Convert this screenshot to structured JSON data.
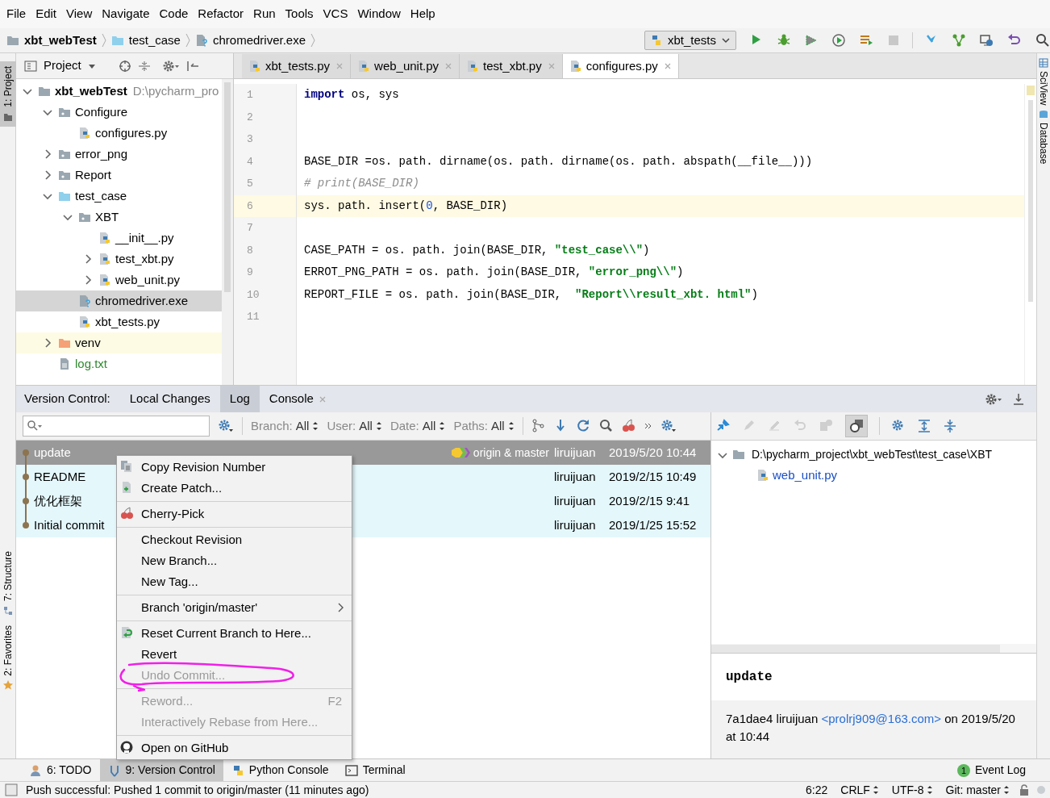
{
  "menu": [
    "File",
    "Edit",
    "View",
    "Navigate",
    "Code",
    "Refactor",
    "Run",
    "Tools",
    "VCS",
    "Window",
    "Help"
  ],
  "breadcrumbs": [
    {
      "label": "xbt_webTest",
      "kind": "root"
    },
    {
      "label": "test_case",
      "kind": "test_root"
    },
    {
      "label": "chromedriver.exe",
      "kind": "unknown"
    }
  ],
  "run_config": "xbt_tests",
  "left_stripe": [
    {
      "label": "1: Project",
      "selected": true
    },
    {
      "label": "7: Structure",
      "selected": false
    },
    {
      "label": "2: Favorites",
      "selected": false
    }
  ],
  "right_stripe": [
    "SciView",
    "Database"
  ],
  "project_panel": {
    "title": "Project",
    "tree": [
      {
        "label": "xbt_webTest",
        "note": "D:\\pycharm_pro",
        "kind": "root",
        "expanded": true,
        "selected": false,
        "added": false,
        "children": [
          {
            "label": "Configure",
            "kind": "package",
            "expanded": true,
            "selected": false,
            "added": false,
            "children": [
              {
                "label": "configures.py",
                "kind": "python",
                "selected": false,
                "added": false
              }
            ]
          },
          {
            "label": "error_png",
            "kind": "package",
            "expanded": false,
            "selected": false,
            "added": false
          },
          {
            "label": "Report",
            "kind": "package",
            "expanded": false,
            "selected": false,
            "added": false
          },
          {
            "label": "test_case",
            "kind": "test_root",
            "expanded": true,
            "selected": false,
            "added": false,
            "children": [
              {
                "label": "XBT",
                "kind": "package",
                "expanded": true,
                "selected": false,
                "added": false,
                "children": [
                  {
                    "label": "__init__.py",
                    "kind": "python",
                    "selected": false,
                    "added": false
                  },
                  {
                    "label": "test_xbt.py",
                    "kind": "python",
                    "expanded": false,
                    "selected": false,
                    "added": false
                  },
                  {
                    "label": "web_unit.py",
                    "kind": "python",
                    "expanded": false,
                    "selected": false,
                    "added": false
                  }
                ]
              },
              {
                "label": "chromedriver.exe",
                "kind": "unknown",
                "selected": true,
                "added": false
              },
              {
                "label": "xbt_tests.py",
                "kind": "python",
                "selected": false,
                "added": false
              }
            ]
          },
          {
            "label": "venv",
            "kind": "excluded",
            "expanded": false,
            "selected": false,
            "added": false
          },
          {
            "label": "log.txt",
            "kind": "text",
            "selected": false,
            "added": true
          }
        ]
      }
    ]
  },
  "editor": {
    "tabs": [
      {
        "label": "xbt_tests.py",
        "selected": false
      },
      {
        "label": "web_unit.py",
        "selected": false
      },
      {
        "label": "test_xbt.py",
        "selected": false
      },
      {
        "label": "configures.py",
        "selected": true
      }
    ],
    "lines": [
      {
        "number": "1",
        "current": false,
        "tokens": [
          {
            "kind": "keyword",
            "text": "import"
          },
          {
            "kind": "plain",
            "text": " os, sys"
          }
        ]
      },
      {
        "number": "2",
        "current": false
      },
      {
        "number": "3",
        "current": false
      },
      {
        "number": "4",
        "current": false,
        "tokens": [
          {
            "kind": "plain",
            "text": "BASE_DIR =os. path. dirname(os. path. dirname(os. path. abspath(__file__)))"
          }
        ]
      },
      {
        "number": "5",
        "current": false,
        "tokens": [
          {
            "kind": "comment",
            "text": "# print(BASE_DIR)"
          }
        ]
      },
      {
        "number": "6",
        "current": true,
        "tokens": [
          {
            "kind": "plain",
            "text": "sys. path. insert("
          },
          {
            "kind": "number",
            "text": "0"
          },
          {
            "kind": "plain",
            "text": ", BASE_DIR)"
          }
        ]
      },
      {
        "number": "7",
        "current": false
      },
      {
        "number": "8",
        "current": false,
        "tokens": [
          {
            "kind": "plain",
            "text": "CASE_PATH = os. path. join(BASE_DIR, "
          },
          {
            "kind": "string",
            "text": "\"test_case\\\\\""
          },
          {
            "kind": "plain",
            "text": ")"
          }
        ]
      },
      {
        "number": "9",
        "current": false,
        "tokens": [
          {
            "kind": "plain",
            "text": "ERROT_PNG_PATH = os. path. join(BASE_DIR, "
          },
          {
            "kind": "string",
            "text": "\"error_png\\\\\""
          },
          {
            "kind": "plain",
            "text": ")"
          }
        ]
      },
      {
        "number": "10",
        "current": false,
        "tokens": [
          {
            "kind": "plain",
            "text": "REPORT_FILE = os. path. join(BASE_DIR,  "
          },
          {
            "kind": "string",
            "text": "\"Report\\\\result_xbt. html\""
          },
          {
            "kind": "plain",
            "text": ")"
          }
        ]
      },
      {
        "number": "11",
        "current": false
      }
    ]
  },
  "version_control": {
    "title": "Version Control:",
    "tabs": [
      {
        "label": "Local Changes",
        "selected": false
      },
      {
        "label": "Log",
        "selected": true
      },
      {
        "label": "Console",
        "selected": false
      }
    ],
    "filters": [
      {
        "label": "Branch:",
        "value": "All"
      },
      {
        "label": "User:",
        "value": "All"
      },
      {
        "label": "Date:",
        "value": "All"
      },
      {
        "label": "Paths:",
        "value": "All"
      }
    ],
    "commits": [
      {
        "subject": "update",
        "refs": "origin & master",
        "author": "liruijuan",
        "date": "2019/5/20 10:44",
        "selected": true
      },
      {
        "subject": "README",
        "author": "liruijuan",
        "date": "2019/2/15 10:49",
        "selected": false
      },
      {
        "subject": "优化框架",
        "author": "liruijuan",
        "date": "2019/2/15 9:41",
        "selected": false
      },
      {
        "subject": "Initial commit",
        "author": "liruijuan",
        "date": "2019/1/25 15:52",
        "selected": false
      }
    ],
    "changes": {
      "path": "D:\\pycharm_project\\xbt_webTest\\test_case\\XBT",
      "files": [
        "web_unit.py"
      ]
    },
    "details": {
      "subject": "update",
      "meta": "7a1dae4 liruijuan",
      "email": "<prolrj909@163.com>",
      "date": "on 2019/5/20 at 10:44"
    }
  },
  "context_menu": [
    {
      "kind": "copy",
      "label": "Copy Revision Number",
      "disabled": false
    },
    {
      "kind": "patch",
      "label": "Create Patch...",
      "disabled": false
    },
    {
      "kind": "separator"
    },
    {
      "kind": "cherry",
      "label": "Cherry-Pick",
      "disabled": false
    },
    {
      "kind": "separator"
    },
    {
      "kind": "plain",
      "label": "Checkout Revision",
      "disabled": false
    },
    {
      "kind": "plain",
      "label": "New Branch...",
      "disabled": false
    },
    {
      "kind": "plain",
      "label": "New Tag...",
      "disabled": false
    },
    {
      "kind": "separator"
    },
    {
      "kind": "submenu",
      "label": "Branch 'origin/master'",
      "disabled": false
    },
    {
      "kind": "separator"
    },
    {
      "kind": "reset",
      "label": "Reset Current Branch to Here...",
      "disabled": false
    },
    {
      "kind": "plain",
      "label": "Revert",
      "disabled": false
    },
    {
      "kind": "plain",
      "label": "Undo Commit...",
      "disabled": true
    },
    {
      "kind": "separator"
    },
    {
      "kind": "plain",
      "label": "Reword...",
      "shortcut": "F2",
      "disabled": true
    },
    {
      "kind": "plain",
      "label": "Interactively Rebase from Here...",
      "disabled": true
    },
    {
      "kind": "separator"
    },
    {
      "kind": "github",
      "label": "Open on GitHub",
      "disabled": false
    }
  ],
  "tool_tabs": [
    {
      "label": "6: TODO",
      "kind": "todo",
      "selected": false
    },
    {
      "label": "9: Version Control",
      "kind": "vcs",
      "selected": true
    },
    {
      "label": "Python Console",
      "kind": "python",
      "selected": false
    },
    {
      "label": "Terminal",
      "kind": "terminal",
      "selected": false
    }
  ],
  "event_log": {
    "count": "1",
    "label": "Event Log"
  },
  "status_bar": {
    "message": "Push successful: Pushed 1 commit to origin/master (11 minutes ago)",
    "items": [
      {
        "label": "6:22",
        "kind": "plain"
      },
      {
        "label": "CRLF",
        "kind": "choice"
      },
      {
        "label": "UTF-8",
        "kind": "choice"
      },
      {
        "label": "Git: master",
        "kind": "choice"
      }
    ]
  }
}
